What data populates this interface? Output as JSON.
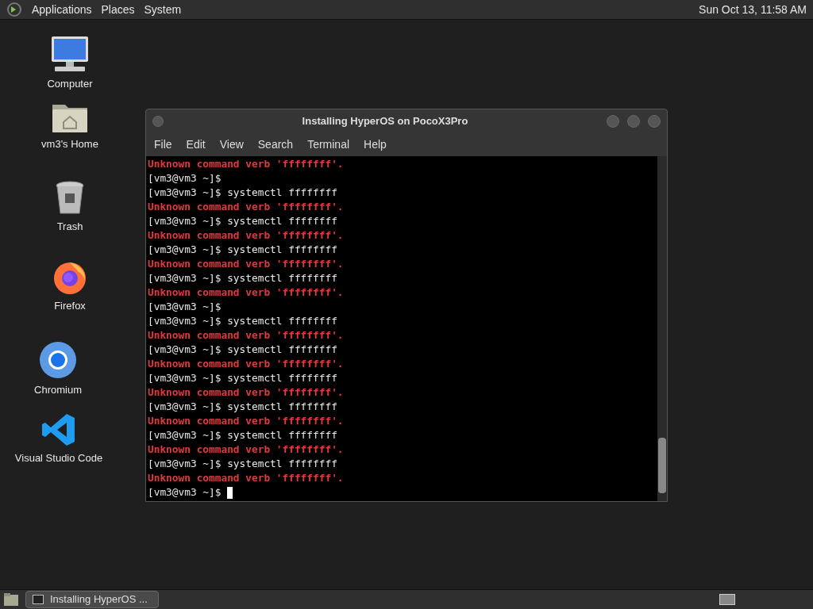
{
  "top_panel": {
    "menus": [
      "Applications",
      "Places",
      "System"
    ],
    "clock": "Sun Oct 13, 11:58 AM"
  },
  "desktop_icons": [
    {
      "kind": "computer",
      "label": "Computer"
    },
    {
      "kind": "home",
      "label": "vm3's Home"
    },
    {
      "kind": "trash",
      "label": "Trash"
    },
    {
      "kind": "firefox",
      "label": "Firefox"
    },
    {
      "kind": "chromium",
      "label": "Chromium"
    },
    {
      "kind": "vscode",
      "label": "Visual Studio Code"
    }
  ],
  "window": {
    "title": "Installing HyperOS on PocoX3Pro",
    "menu": [
      "File",
      "Edit",
      "View",
      "Search",
      "Terminal",
      "Help"
    ],
    "lines": [
      {
        "kind": "error",
        "text": "Unknown command verb 'ffffffff'."
      },
      {
        "kind": "prompt",
        "text": "[vm3@vm3 ~]$"
      },
      {
        "kind": "prompt",
        "text": "[vm3@vm3 ~]$ systemctl ffffffff"
      },
      {
        "kind": "error",
        "text": "Unknown command verb 'ffffffff'."
      },
      {
        "kind": "prompt",
        "text": "[vm3@vm3 ~]$ systemctl ffffffff"
      },
      {
        "kind": "error",
        "text": "Unknown command verb 'ffffffff'."
      },
      {
        "kind": "prompt",
        "text": "[vm3@vm3 ~]$ systemctl ffffffff"
      },
      {
        "kind": "error",
        "text": "Unknown command verb 'ffffffff'."
      },
      {
        "kind": "prompt",
        "text": "[vm3@vm3 ~]$ systemctl ffffffff"
      },
      {
        "kind": "error",
        "text": "Unknown command verb 'ffffffff'."
      },
      {
        "kind": "prompt",
        "text": "[vm3@vm3 ~]$"
      },
      {
        "kind": "prompt",
        "text": "[vm3@vm3 ~]$ systemctl ffffffff"
      },
      {
        "kind": "error",
        "text": "Unknown command verb 'ffffffff'."
      },
      {
        "kind": "prompt",
        "text": "[vm3@vm3 ~]$ systemctl ffffffff"
      },
      {
        "kind": "error",
        "text": "Unknown command verb 'ffffffff'."
      },
      {
        "kind": "prompt",
        "text": "[vm3@vm3 ~]$ systemctl ffffffff"
      },
      {
        "kind": "error",
        "text": "Unknown command verb 'ffffffff'."
      },
      {
        "kind": "prompt",
        "text": "[vm3@vm3 ~]$ systemctl ffffffff"
      },
      {
        "kind": "error",
        "text": "Unknown command verb 'ffffffff'."
      },
      {
        "kind": "prompt",
        "text": "[vm3@vm3 ~]$ systemctl ffffffff"
      },
      {
        "kind": "error",
        "text": "Unknown command verb 'ffffffff'."
      },
      {
        "kind": "prompt",
        "text": "[vm3@vm3 ~]$ systemctl ffffffff"
      },
      {
        "kind": "error",
        "text": "Unknown command verb 'ffffffff'."
      },
      {
        "kind": "prompt",
        "text": "[vm3@vm3 ~]$",
        "cursor": true
      }
    ]
  },
  "taskbar": {
    "tasks": [
      {
        "label": "Installing HyperOS ...",
        "selected": true
      }
    ]
  }
}
